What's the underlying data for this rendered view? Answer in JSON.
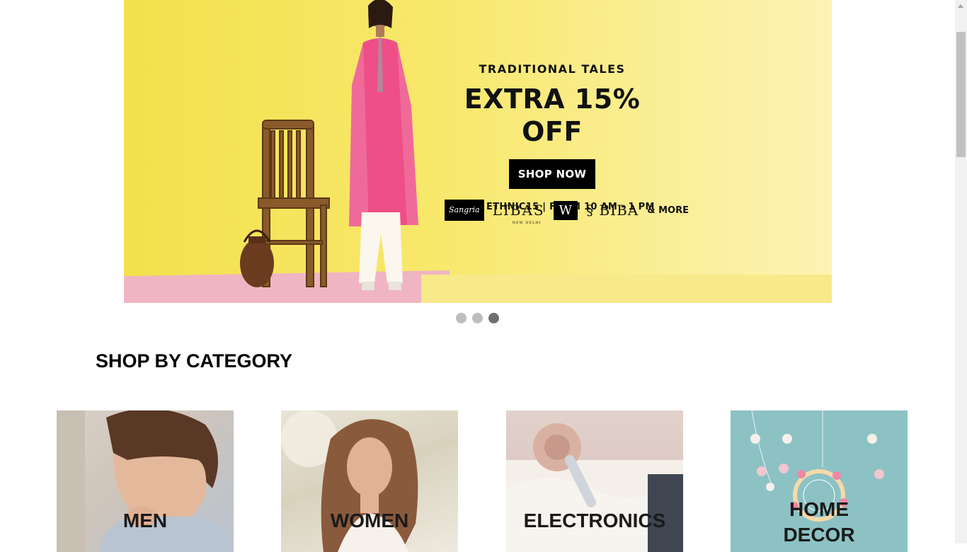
{
  "banner": {
    "eyebrow": "TRADITIONAL TALES",
    "headline": "EXTRA 15% OFF",
    "cta_label": "SHOP NOW",
    "code_line": "CODE: ETHNIC15 | FROM 10 AM - 1 PM",
    "brands": {
      "b1": "Sangria",
      "b2": "LIBAS",
      "b2_sub": "NEW DELHI",
      "b3": "W",
      "b4": "BIBA",
      "more": "& MORE"
    },
    "colors": {
      "background": "#f6e45e",
      "accent_pink": "#e93c78"
    }
  },
  "carousel": {
    "slides": 3,
    "active_index": 2
  },
  "section": {
    "title": "SHOP BY CATEGORY"
  },
  "categories": [
    {
      "label": "MEN",
      "icon": "man-portrait-image"
    },
    {
      "label": "WOMEN",
      "icon": "woman-portrait-image"
    },
    {
      "label": "ELECTRONICS",
      "icon": "headphones-image"
    },
    {
      "label": "HOME\nDECOR",
      "label_line1": "HOME",
      "label_line2": "DECOR",
      "icon": "dreamcatcher-image"
    }
  ]
}
